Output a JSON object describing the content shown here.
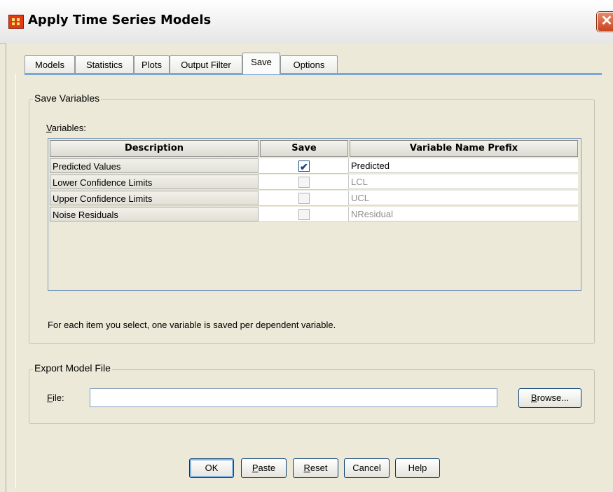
{
  "window": {
    "title": "Apply Time Series Models",
    "close_symbol": "✕"
  },
  "tabs": [
    {
      "label": "Models"
    },
    {
      "label": "Statistics"
    },
    {
      "label": "Plots"
    },
    {
      "label": "Output Filter"
    },
    {
      "label": "Save",
      "active": true
    },
    {
      "label": "Options"
    }
  ],
  "save_variables": {
    "legend": "Save Variables",
    "variables_label_accel": "V",
    "variables_label_rest": "ariables:",
    "columns": [
      "Description",
      "Save",
      "Variable Name Prefix"
    ],
    "rows": [
      {
        "description": "Predicted Values",
        "save": true,
        "prefix": "Predicted"
      },
      {
        "description": "Lower Confidence Limits",
        "save": false,
        "prefix": "LCL"
      },
      {
        "description": "Upper Confidence Limits",
        "save": false,
        "prefix": "UCL"
      },
      {
        "description": "Noise Residuals",
        "save": false,
        "prefix": "NResidual"
      }
    ],
    "note": "For each item you select, one variable is saved per dependent variable."
  },
  "export_model": {
    "legend": "Export Model File",
    "file_label_accel": "F",
    "file_label_rest": "ile:",
    "file_value": "",
    "browse_accel": "B",
    "browse_rest": "rowse..."
  },
  "buttons": {
    "ok": "OK",
    "paste_accel": "P",
    "paste_rest": "aste",
    "reset_accel": "R",
    "reset_rest": "eset",
    "cancel": "Cancel",
    "help": "Help"
  },
  "colors": {
    "accent": "#7ca6d8",
    "check": "#1f3d8c",
    "close": "#c8461f"
  }
}
